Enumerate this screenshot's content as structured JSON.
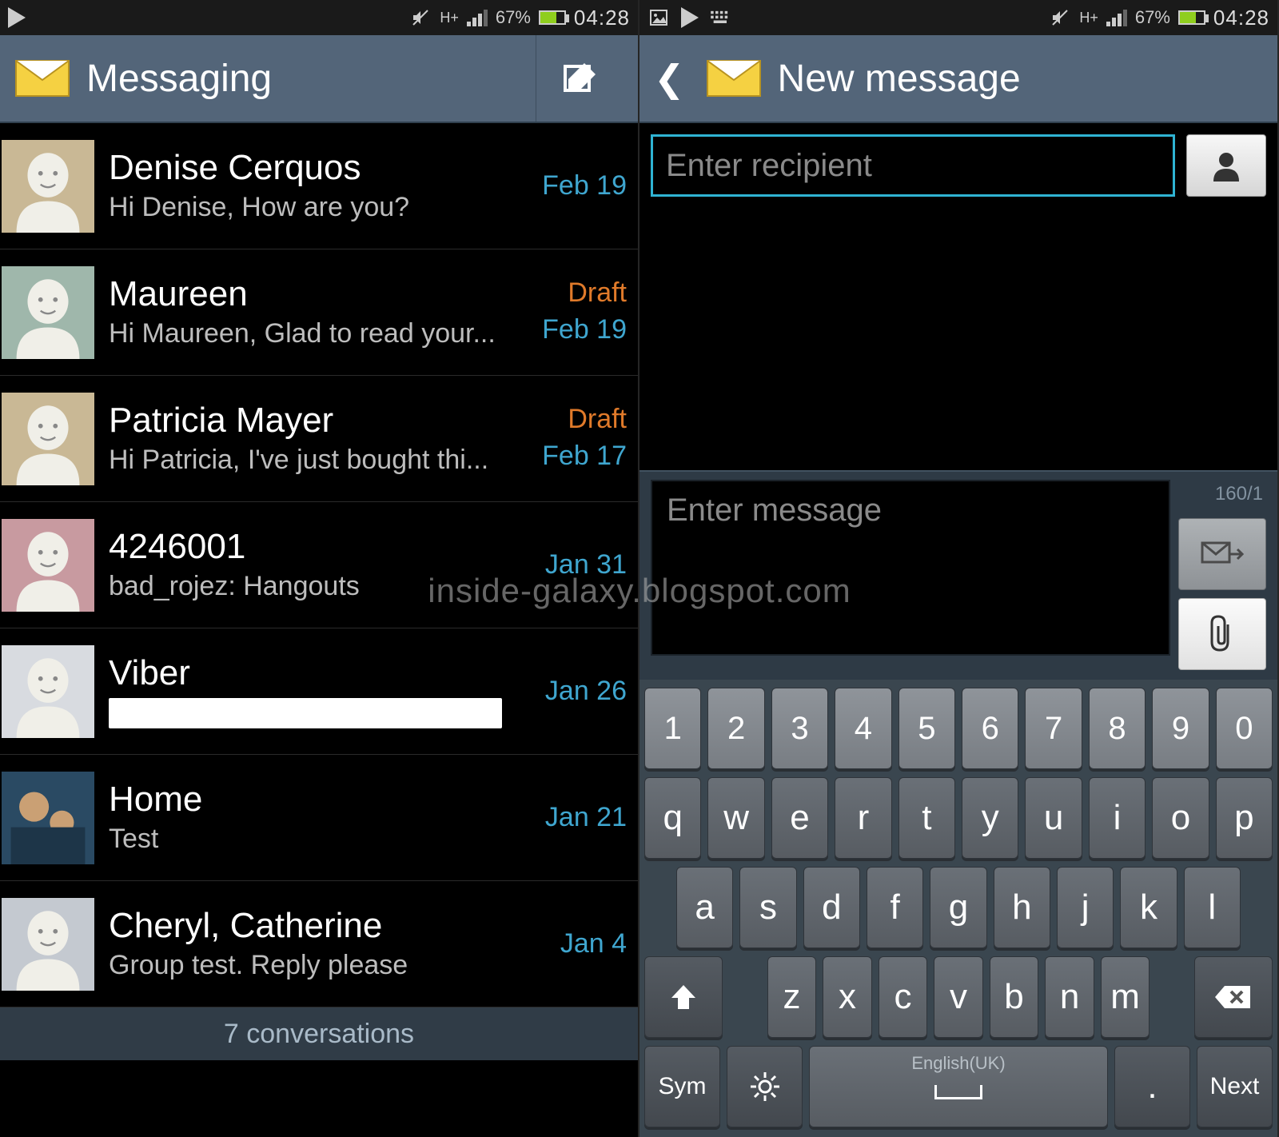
{
  "status": {
    "battery_pct": "67%",
    "clock": "04:28",
    "network_label": "H+"
  },
  "left": {
    "title": "Messaging",
    "footer": "7 conversations",
    "conversations": [
      {
        "name": "Denise Cerquos",
        "snippet": "Hi Denise, How are you?",
        "date": "Feb 19",
        "draft": "",
        "avatar_bg": "#c9b895"
      },
      {
        "name": "Maureen",
        "snippet": "Hi Maureen, Glad to read your...",
        "date": "Feb 19",
        "draft": "Draft",
        "avatar_bg": "#9fb7ab"
      },
      {
        "name": "Patricia Mayer",
        "snippet": "Hi Patricia, I've just bought thi...",
        "date": "Feb 17",
        "draft": "Draft",
        "avatar_bg": "#c9b895"
      },
      {
        "name": "4246001",
        "snippet": "bad_rojez: Hangouts",
        "date": "Jan 31",
        "draft": "",
        "avatar_bg": "#c89aa0"
      },
      {
        "name": "Viber",
        "snippet": "",
        "date": "Jan 26",
        "draft": "",
        "avatar_bg": "#d8dbe0",
        "snippet_whitebox": true
      },
      {
        "name": "Home",
        "snippet": "Test",
        "date": "Jan 21",
        "draft": "",
        "avatar_bg": "#3a5f7a",
        "photo": true
      },
      {
        "name": "Cheryl, Catherine",
        "snippet": "Group test. Reply please",
        "date": "Jan 4",
        "draft": "",
        "avatar_bg": "#c4c9d0"
      }
    ]
  },
  "right": {
    "title": "New message",
    "recipient_placeholder": "Enter recipient",
    "message_placeholder": "Enter message",
    "char_counter": "160/1"
  },
  "keyboard": {
    "row1": [
      "1",
      "2",
      "3",
      "4",
      "5",
      "6",
      "7",
      "8",
      "9",
      "0"
    ],
    "row2": [
      "q",
      "w",
      "e",
      "r",
      "t",
      "y",
      "u",
      "i",
      "o",
      "p"
    ],
    "row3": [
      "a",
      "s",
      "d",
      "f",
      "g",
      "h",
      "j",
      "k",
      "l"
    ],
    "row4": [
      "z",
      "x",
      "c",
      "v",
      "b",
      "n",
      "m"
    ],
    "sym": "Sym",
    "next": "Next",
    "space_lang": "English(UK)"
  },
  "watermark": "inside-galaxy.blogspot.com"
}
